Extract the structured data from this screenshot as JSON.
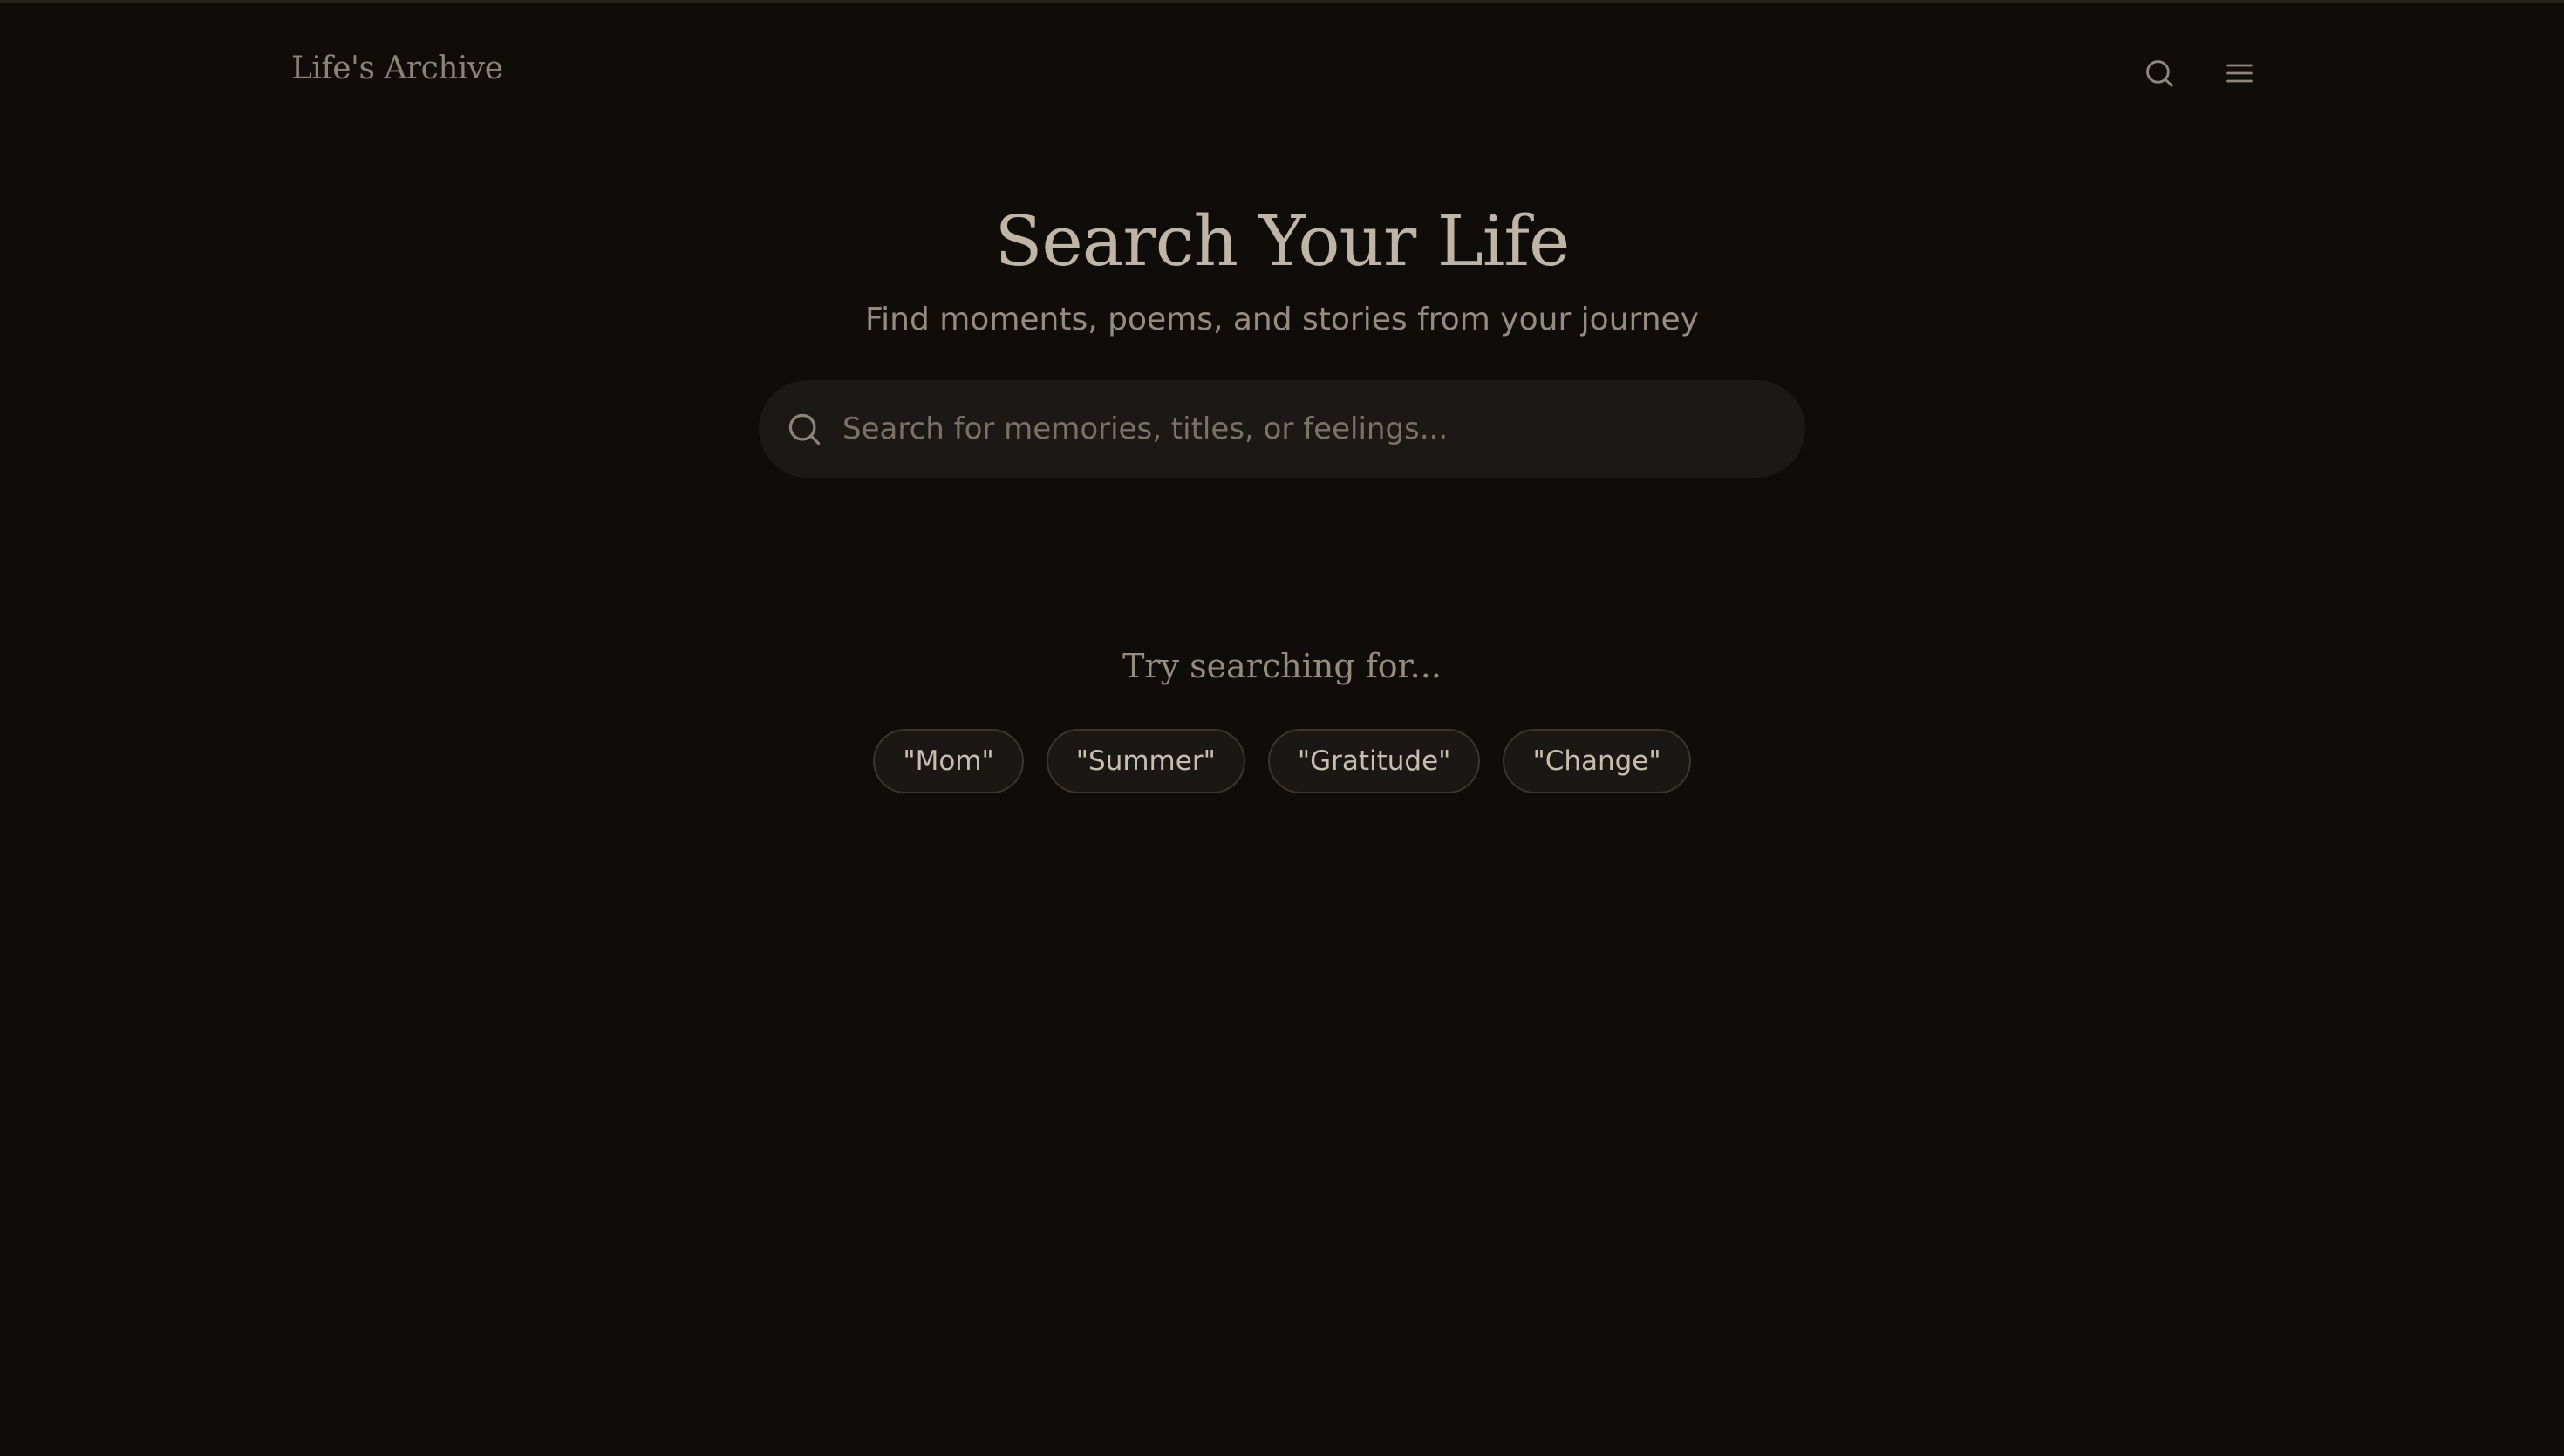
{
  "header": {
    "brand": "Life's Archive",
    "search_icon": "search-icon",
    "menu_icon": "menu-icon"
  },
  "hero": {
    "title": "Search Your Life",
    "subtitle": "Find moments, poems, and stories from your journey"
  },
  "search": {
    "placeholder": "Search for memories, titles, or feelings...",
    "value": ""
  },
  "suggestions": {
    "heading": "Try searching for...",
    "chips": [
      "\"Mom\"",
      "\"Summer\"",
      "\"Gratitude\"",
      "\"Change\""
    ]
  },
  "colors": {
    "background": "#0f0c0a",
    "title": "#bfb4a6",
    "muted": "#958b7f",
    "search_bg": "#1b1815",
    "chip_border": "#3a3530"
  }
}
